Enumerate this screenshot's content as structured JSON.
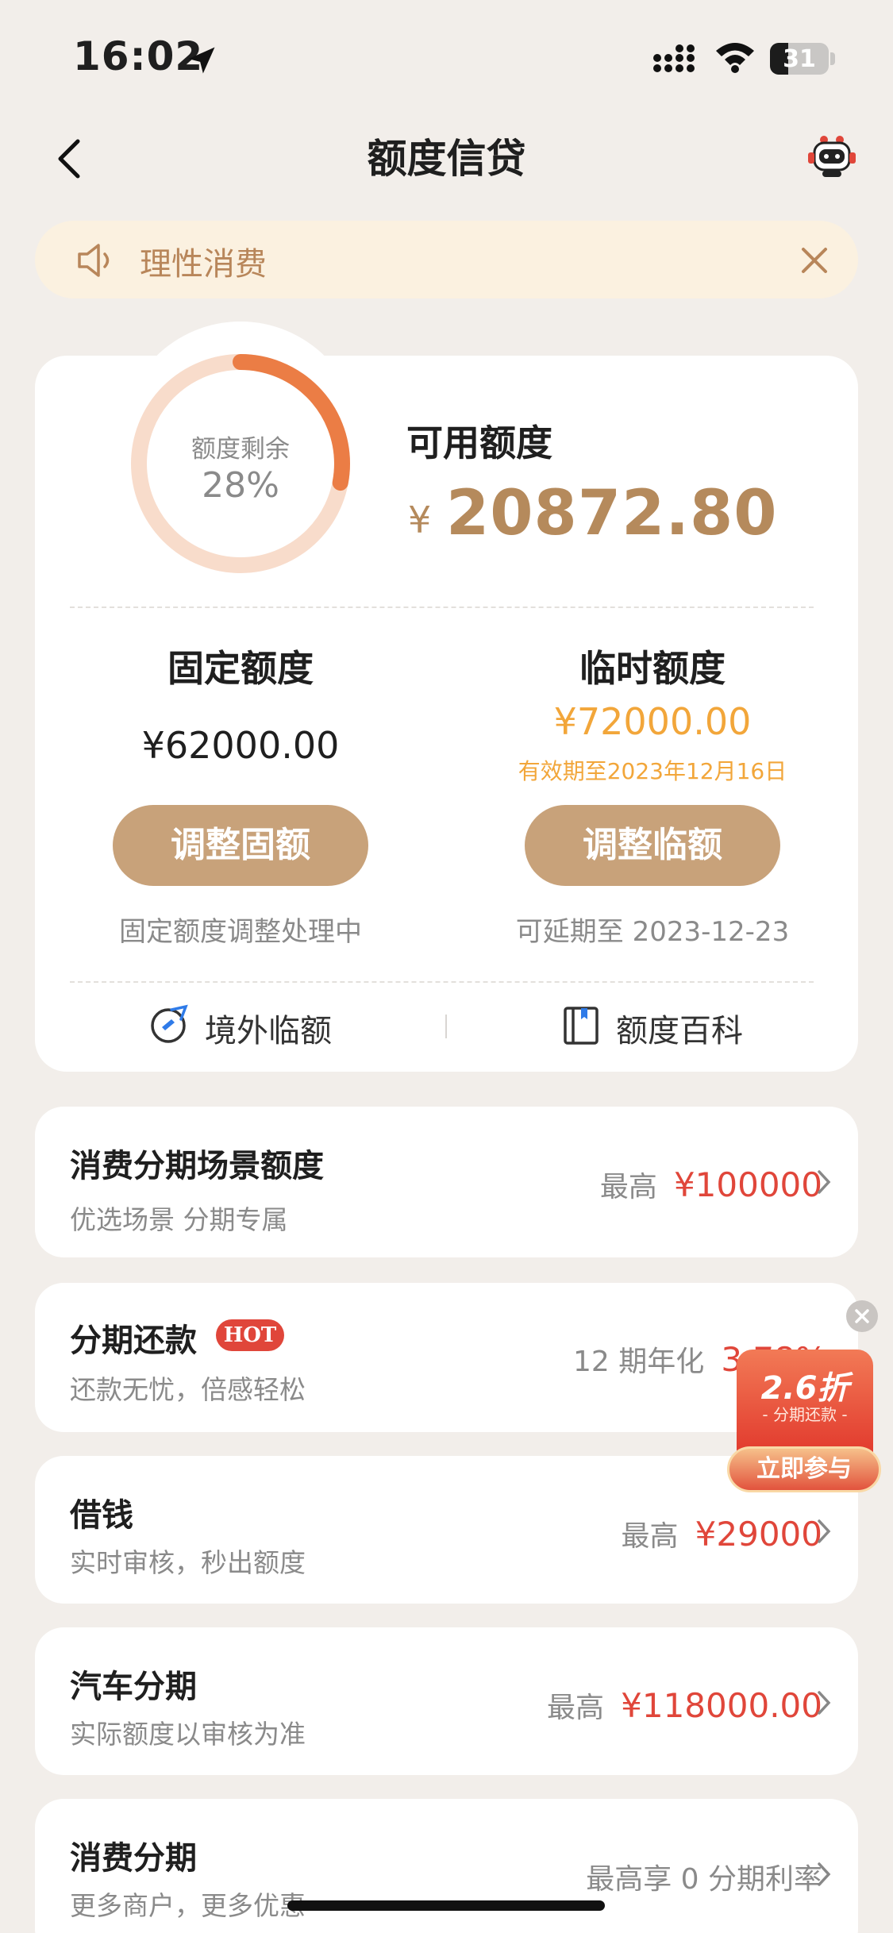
{
  "status_bar": {
    "time": "16:02",
    "battery": "31",
    "battery_level": 0.31
  },
  "nav": {
    "title": "额度信贷"
  },
  "notice": {
    "text": "理性消费"
  },
  "credit": {
    "ring_label": "额度剩余",
    "ring_percent": "28%",
    "ring_fraction": 0.28,
    "available_label": "可用额度",
    "available_currency": "¥",
    "available_amount": "20872.80",
    "fixed": {
      "title": "固定额度",
      "amount": "¥62000.00",
      "button": "调整固额",
      "note": "固定额度调整处理中"
    },
    "temporary": {
      "title": "临时额度",
      "amount": "¥72000.00",
      "expiry": "有效期至2023年12月16日",
      "button": "调整临额",
      "note": "可延期至 2023-12-23"
    },
    "links": [
      {
        "label": "境外临额",
        "icon": "plane-globe-icon"
      },
      {
        "label": "额度百科",
        "icon": "book-icon"
      }
    ]
  },
  "products": [
    {
      "title": "消费分期场景额度",
      "subtitle": "优选场景 分期专属",
      "right_label": "最高",
      "right_value": "¥100000"
    },
    {
      "title": "分期还款",
      "badge": "HOT",
      "subtitle": "还款无忧，倍感轻松",
      "right_label": "12 期年化",
      "right_value": "3.78%"
    },
    {
      "title": "借钱",
      "subtitle": "实时审核，秒出额度",
      "right_label": "最高",
      "right_value": "¥29000"
    },
    {
      "title": "汽车分期",
      "subtitle": "实际额度以审核为准",
      "right_label": "最高",
      "right_value": "¥118000.00"
    },
    {
      "title": "消费分期",
      "subtitle": "更多商户，更多优惠",
      "right_label": "最高享 0 分期利率",
      "right_value": ""
    }
  ],
  "promo": {
    "discount": "2.6折",
    "subtitle": "- 分期还款 -",
    "button": "立即参与"
  },
  "colors": {
    "accent": "#c8a27a",
    "gold_text": "#b58a5c",
    "temp_orange": "#f2a63a",
    "red": "#e0463a",
    "ring": "#eb7d45"
  }
}
